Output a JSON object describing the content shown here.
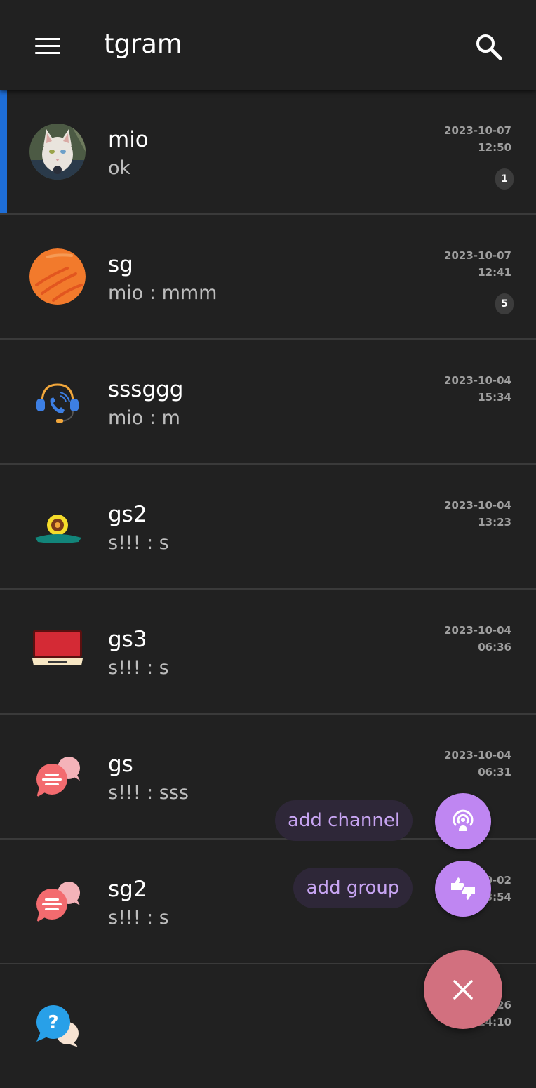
{
  "app": {
    "title": "tgram",
    "accent_color": "#1e6ed8"
  },
  "chats": [
    {
      "name": "mio",
      "preview": "ok",
      "date": "2023-10-07",
      "time": "12:50",
      "unread": "1",
      "avatar": "cat-photo",
      "selected": true
    },
    {
      "name": "sg",
      "preview": "mio : mmm",
      "date": "2023-10-07",
      "time": "12:41",
      "unread": "5",
      "avatar": "orange-planet-icon"
    },
    {
      "name": "sssggg",
      "preview": "mio : m",
      "date": "2023-10-04",
      "time": "15:34",
      "avatar": "headset-icon"
    },
    {
      "name": "gs2",
      "preview": "s!!! : s",
      "date": "2023-10-04",
      "time": "13:23",
      "avatar": "flower-icon"
    },
    {
      "name": "gs3",
      "preview": "s!!! : s",
      "date": "2023-10-04",
      "time": "06:36",
      "avatar": "laptop-icon"
    },
    {
      "name": "gs",
      "preview": "s!!! : sss",
      "date": "2023-10-04",
      "time": "06:31",
      "avatar": "chat-bubbles-icon"
    },
    {
      "name": "sg2",
      "preview": "s!!! : s",
      "date": "0-02",
      "time": "3:54",
      "avatar": "chat-bubbles-icon"
    },
    {
      "name": "",
      "preview": "",
      "date": "26",
      "time": "14:10",
      "avatar": "help-bubble-icon"
    }
  ],
  "fab": {
    "add_channel_label": "add channel",
    "add_group_label": "add group",
    "mini_fab_color": "#bf86f2",
    "main_fab_color": "#d2707f",
    "channel_icon": "podcast-icon",
    "group_icon": "thumbs-icon",
    "close_icon": "close-icon"
  }
}
